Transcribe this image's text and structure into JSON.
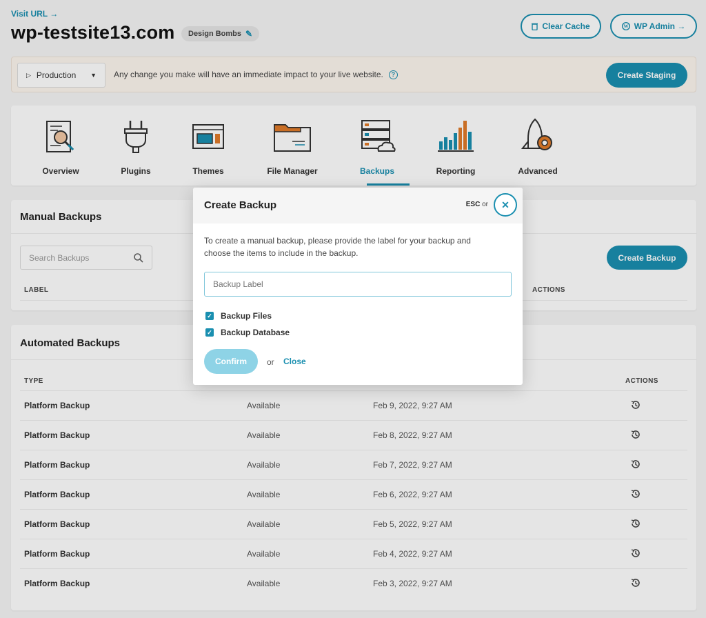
{
  "header": {
    "visit_url": "Visit URL →",
    "site_name": "wp-testsite13.com",
    "tag": "Design Bombs",
    "clear_cache": "Clear Cache",
    "wp_admin": "WP Admin →"
  },
  "banner": {
    "environment": "Production",
    "message": "Any change you make will have an immediate impact to your live website.",
    "create_staging": "Create Staging"
  },
  "nav": {
    "items": [
      {
        "label": "Overview",
        "icon": "overview-icon"
      },
      {
        "label": "Plugins",
        "icon": "plug-icon"
      },
      {
        "label": "Themes",
        "icon": "themes-icon"
      },
      {
        "label": "File Manager",
        "icon": "folder-icon"
      },
      {
        "label": "Backups",
        "icon": "server-cloud-icon"
      },
      {
        "label": "Reporting",
        "icon": "bar-chart-icon"
      },
      {
        "label": "Advanced",
        "icon": "rocket-gear-icon"
      }
    ],
    "active": "Backups"
  },
  "manual_backups": {
    "title": "Manual Backups",
    "search_placeholder": "Search Backups",
    "create_button": "Create Backup",
    "columns": {
      "label": "LABEL",
      "actions": "ACTIONS"
    }
  },
  "automated_backups": {
    "title": "Automated Backups",
    "columns": {
      "type": "TYPE",
      "actions": "ACTIONS"
    },
    "rows": [
      {
        "type": "Platform Backup",
        "status": "Available",
        "date": "Feb 9, 2022, 9:27 AM"
      },
      {
        "type": "Platform Backup",
        "status": "Available",
        "date": "Feb 8, 2022, 9:27 AM"
      },
      {
        "type": "Platform Backup",
        "status": "Available",
        "date": "Feb 7, 2022, 9:27 AM"
      },
      {
        "type": "Platform Backup",
        "status": "Available",
        "date": "Feb 6, 2022, 9:27 AM"
      },
      {
        "type": "Platform Backup",
        "status": "Available",
        "date": "Feb 5, 2022, 9:27 AM"
      },
      {
        "type": "Platform Backup",
        "status": "Available",
        "date": "Feb 4, 2022, 9:27 AM"
      },
      {
        "type": "Platform Backup",
        "status": "Available",
        "date": "Feb 3, 2022, 9:27 AM"
      }
    ]
  },
  "modal": {
    "title": "Create Backup",
    "esc": "ESC",
    "esc_or": "or",
    "description": "To create a manual backup, please provide the label for your backup and choose the items to include in the backup.",
    "label_placeholder": "Backup Label",
    "options": [
      {
        "label": "Backup Files",
        "checked": true
      },
      {
        "label": "Backup Database",
        "checked": true
      }
    ],
    "confirm": "Confirm",
    "or": "or",
    "close": "Close"
  },
  "colors": {
    "accent": "#1a8fb0",
    "confirm_disabled": "#8ed3e6",
    "icon_orange": "#e07b2a"
  }
}
